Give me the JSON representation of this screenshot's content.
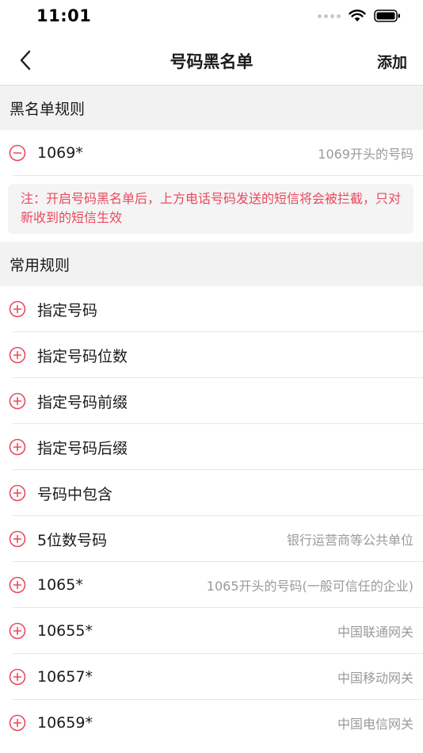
{
  "status_bar": {
    "time": "11:01"
  },
  "nav": {
    "title": "号码黑名单",
    "add_label": "添加"
  },
  "blacklist": {
    "header": "黑名单规则",
    "items": [
      {
        "label": "1069*",
        "desc": "1069开头的号码"
      }
    ],
    "note": "注：开启号码黑名单后，上方电话号码发送的短信将会被拦截，只对新收到的短信生效"
  },
  "common": {
    "header": "常用规则",
    "items": [
      {
        "label": "指定号码",
        "desc": ""
      },
      {
        "label": "指定号码位数",
        "desc": ""
      },
      {
        "label": "指定号码前缀",
        "desc": ""
      },
      {
        "label": "指定号码后缀",
        "desc": ""
      },
      {
        "label": "号码中包含",
        "desc": ""
      },
      {
        "label": "5位数号码",
        "desc": "银行运营商等公共单位"
      },
      {
        "label": "1065*",
        "desc": "1065开头的号码(一般可信任的企业)"
      },
      {
        "label": "10655*",
        "desc": "中国联通网关"
      },
      {
        "label": "10657*",
        "desc": "中国移动网关"
      },
      {
        "label": "10659*",
        "desc": "中国电信网关"
      }
    ]
  },
  "icons": {
    "remove": "minus-circle-icon",
    "add": "plus-circle-icon"
  },
  "colors": {
    "accent": "#e84a5f",
    "section_bg": "#f2f2f2",
    "secondary_text": "#9a9a9a"
  }
}
